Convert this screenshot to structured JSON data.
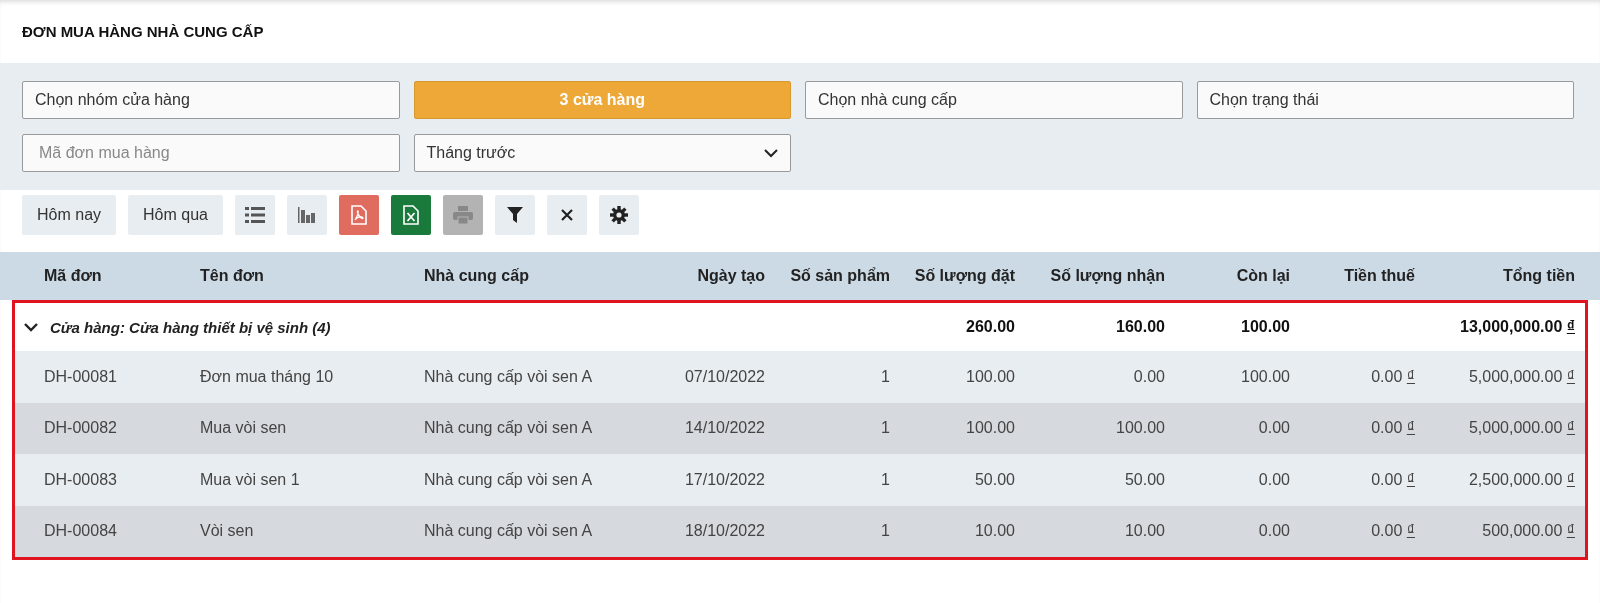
{
  "title": "ĐƠN MUA HÀNG NHÀ CUNG CẤP",
  "filters": [
    {
      "kind": "select",
      "label": "Chọn nhóm cửa hàng"
    },
    {
      "kind": "button",
      "label": "3 cửa hàng"
    },
    {
      "kind": "select",
      "label": "Chọn nhà cung cấp"
    },
    {
      "kind": "select",
      "label": "Chọn trạng thái"
    },
    {
      "kind": "input",
      "placeholder": "Mã đơn mua hàng"
    },
    {
      "kind": "dropdown",
      "label": "Tháng trước"
    }
  ],
  "toolbar": [
    {
      "kind": "text",
      "label": "Hôm nay",
      "disabled": false
    },
    {
      "kind": "text",
      "label": "Hôm qua",
      "disabled": false
    },
    {
      "kind": "list",
      "disabled": false
    },
    {
      "kind": "chart",
      "disabled": false
    },
    {
      "kind": "pdf",
      "disabled": false
    },
    {
      "kind": "excel",
      "disabled": false
    },
    {
      "kind": "print",
      "disabled": true
    },
    {
      "kind": "filter",
      "disabled": false
    },
    {
      "kind": "clear",
      "disabled": false
    },
    {
      "kind": "settings",
      "disabled": false
    }
  ],
  "table": {
    "columns": [
      "Mã đơn",
      "Tên đơn",
      "Nhà cung cấp",
      "Ngày tạo",
      "Số sản phẩm",
      "Số lượng đặt",
      "Số lượng nhận",
      "Còn lại",
      "Tiền thuế",
      "Tổng tiền"
    ],
    "group": {
      "label": "Cửa hàng: Cửa hàng thiết bị vệ sinh (4)",
      "expanded": true,
      "highlighted": true,
      "ordered": "260.00",
      "received": "160.00",
      "remaining": "100.00",
      "total": {
        "amount": "13,000,000.00",
        "currency": "₫"
      }
    },
    "rows": [
      {
        "code": "DH-00081",
        "name": "Đơn mua tháng 10",
        "supplier": "Nhà cung cấp vòi sen A",
        "date": "07/10/2022",
        "products": "1",
        "ordered": "100.00",
        "received": "0.00",
        "remaining": "100.00",
        "tax": {
          "amount": "0.00",
          "currency": "₫"
        },
        "total": {
          "amount": "5,000,000.00",
          "currency": "₫"
        }
      },
      {
        "code": "DH-00082",
        "name": "Mua vòi sen",
        "supplier": "Nhà cung cấp vòi sen A",
        "date": "14/10/2022",
        "products": "1",
        "ordered": "100.00",
        "received": "100.00",
        "remaining": "0.00",
        "tax": {
          "amount": "0.00",
          "currency": "₫"
        },
        "total": {
          "amount": "5,000,000.00",
          "currency": "₫"
        }
      },
      {
        "code": "DH-00083",
        "name": "Mua vòi sen 1",
        "supplier": "Nhà cung cấp vòi sen A",
        "date": "17/10/2022",
        "products": "1",
        "ordered": "50.00",
        "received": "50.00",
        "remaining": "0.00",
        "tax": {
          "amount": "0.00",
          "currency": "₫"
        },
        "total": {
          "amount": "2,500,000.00",
          "currency": "₫"
        }
      },
      {
        "code": "DH-00084",
        "name": "Vòi sen",
        "supplier": "Nhà cung cấp vòi sen A",
        "date": "18/10/2022",
        "products": "1",
        "ordered": "10.00",
        "received": "10.00",
        "remaining": "0.00",
        "tax": {
          "amount": "0.00",
          "currency": "₫"
        },
        "total": {
          "amount": "500,000.00",
          "currency": "₫"
        }
      }
    ]
  }
}
